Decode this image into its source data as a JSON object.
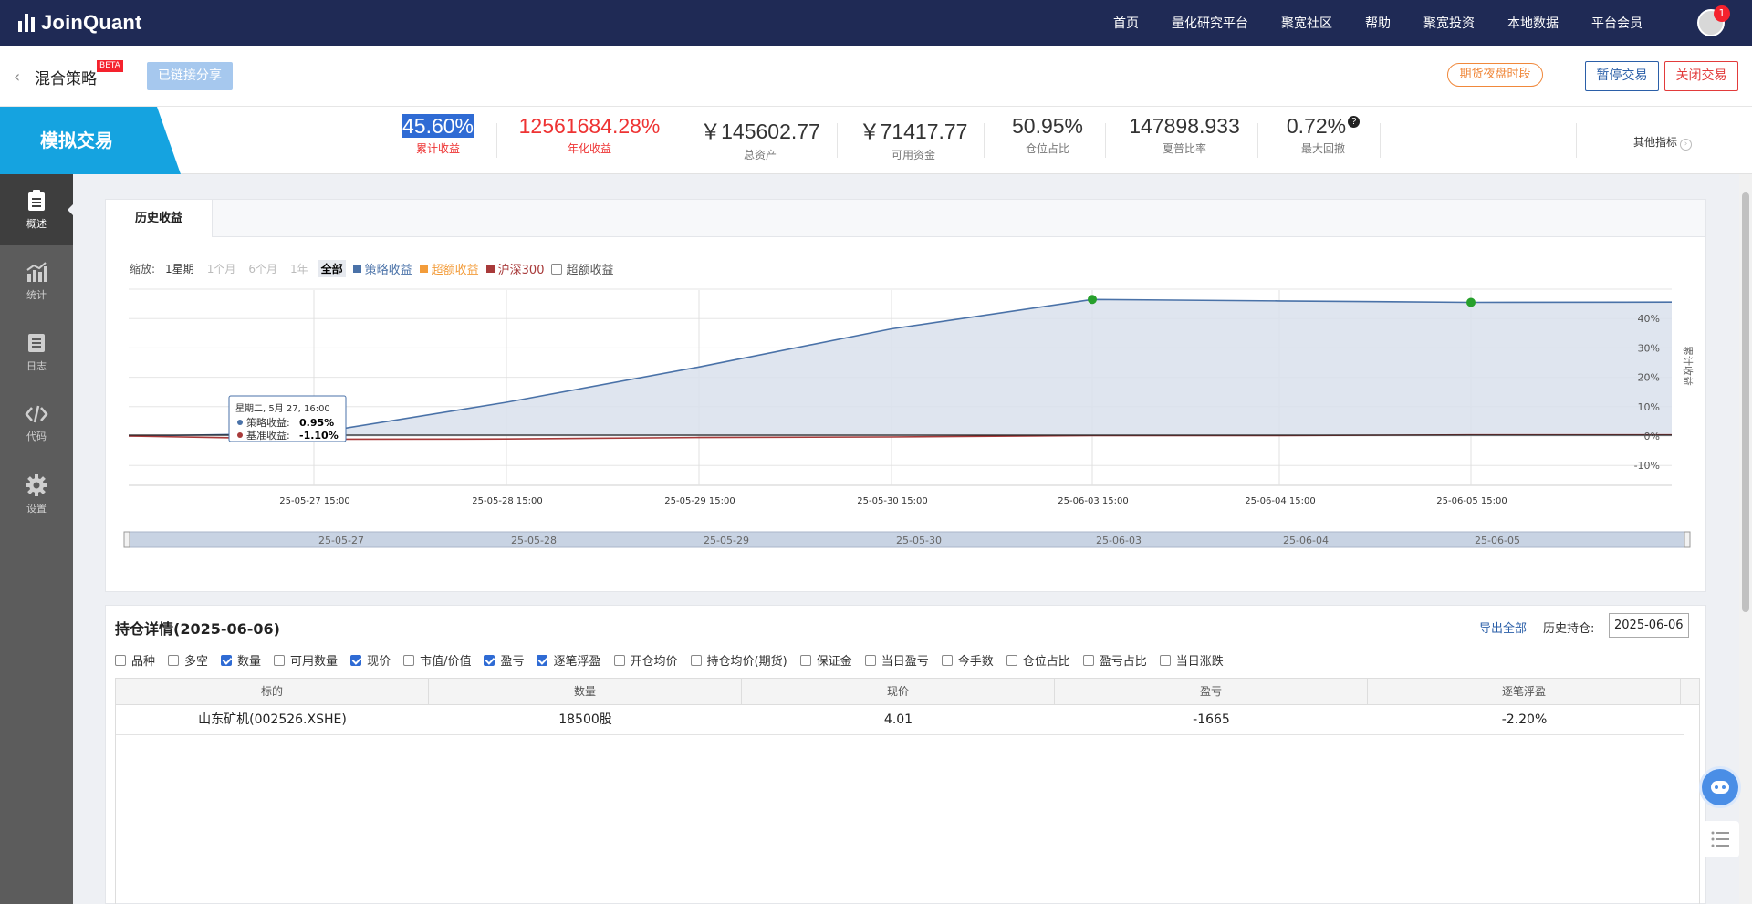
{
  "brand": {
    "name": "JoinQuant"
  },
  "nav": [
    "首页",
    "量化研究平台",
    "聚宽社区",
    "帮助",
    "聚宽投资",
    "本地数据",
    "平台会员"
  ],
  "notif_count": "1",
  "header": {
    "back": "‹",
    "title": "混合策略",
    "beta": "BETA",
    "share_label": "已链接分享",
    "night_session": "期货夜盘时段",
    "pause_label": "暂停交易",
    "close_label": "关闭交易"
  },
  "stats": {
    "tag": "模拟交易",
    "items": [
      {
        "value": "45.60%",
        "label": "累计收益"
      },
      {
        "value": "12561684.28%",
        "label": "年化收益"
      },
      {
        "value": "￥145602.77",
        "label": "总资产"
      },
      {
        "value": "￥71417.77",
        "label": "可用资金"
      },
      {
        "value": "50.95%",
        "label": "仓位占比"
      },
      {
        "value": "147898.933",
        "label": "夏普比率"
      },
      {
        "value": "0.72%",
        "label": "最大回撤"
      }
    ],
    "other": "其他指标"
  },
  "sidebar": [
    {
      "label": "概述",
      "icon": "clipboard-icon"
    },
    {
      "label": "统计",
      "icon": "bar-chart-icon"
    },
    {
      "label": "日志",
      "icon": "list-icon"
    },
    {
      "label": "代码",
      "icon": "code-icon"
    },
    {
      "label": "设置",
      "icon": "gear-icon"
    }
  ],
  "chart_panel": {
    "tab": "历史收益",
    "zoom_label": "缩放:",
    "zoom_options": [
      "1星期",
      "1个月",
      "6个月",
      "1年",
      "全部"
    ],
    "legend": [
      {
        "name": "策略收益",
        "color": "#4a72a8"
      },
      {
        "name": "超额收益",
        "color": "#f39c3a"
      },
      {
        "name": "沪深300",
        "color": "#a83a3a"
      }
    ],
    "excess_checkbox": "超额收益",
    "y_axis_title": "累计收益",
    "tooltip": {
      "date": "星期二, 5月 27, 16:00",
      "line1_label": "策略收益:",
      "line1_value": "0.95%",
      "line2_label": "基准收益:",
      "line2_value": "-1.10%"
    },
    "navigator_labels": [
      "25-05-27",
      "25-05-28",
      "25-05-29",
      "25-05-30",
      "25-06-03",
      "25-06-04",
      "25-06-05"
    ]
  },
  "chart_data": {
    "type": "area",
    "x": [
      "25-05-26 15:00",
      "25-05-27 15:00",
      "25-05-28 15:00",
      "25-05-29 15:00",
      "25-05-30 15:00",
      "25-06-03 15:00",
      "25-06-04 15:00",
      "25-06-05 15:00",
      "25-06-06 15:00"
    ],
    "x_tick_labels": [
      "25-05-27 15:00",
      "25-05-28 15:00",
      "25-05-29 15:00",
      "25-05-30 15:00",
      "25-06-03 15:00",
      "25-06-04 15:00",
      "25-06-05 15:00"
    ],
    "series": [
      {
        "name": "策略收益",
        "color": "#4a72a8",
        "values": [
          0,
          0.95,
          11.5,
          23.5,
          36.5,
          46.5,
          46.0,
          45.5,
          45.6
        ]
      },
      {
        "name": "沪深300",
        "color": "#a83a3a",
        "values": [
          0,
          -1.1,
          -1.0,
          -0.5,
          -0.3,
          0.2,
          0.2,
          0.4,
          0.4
        ]
      }
    ],
    "y_ticks": [
      "-10%",
      "0%",
      "10%",
      "20%",
      "30%",
      "40%"
    ],
    "ylim": [
      -10,
      50
    ],
    "ylabel": "累计收益",
    "markers": [
      {
        "x": "25-06-03 15:00",
        "value": 46.5
      },
      {
        "x": "25-06-05 15:00",
        "value": 45.5
      }
    ],
    "grid": true
  },
  "holdings": {
    "title": "持仓详情(2025-06-06)",
    "export": "导出全部",
    "history_label": "历史持仓:",
    "history_date": "2025-06-06",
    "columns_options": [
      {
        "label": "品种",
        "checked": false
      },
      {
        "label": "多空",
        "checked": false
      },
      {
        "label": "数量",
        "checked": true
      },
      {
        "label": "可用数量",
        "checked": false
      },
      {
        "label": "现价",
        "checked": true
      },
      {
        "label": "市值/价值",
        "checked": false
      },
      {
        "label": "盈亏",
        "checked": true
      },
      {
        "label": "逐笔浮盈",
        "checked": true
      },
      {
        "label": "开仓均价",
        "checked": false
      },
      {
        "label": "持仓均价(期货)",
        "checked": false
      },
      {
        "label": "保证金",
        "checked": false
      },
      {
        "label": "当日盈亏",
        "checked": false
      },
      {
        "label": "今手数",
        "checked": false
      },
      {
        "label": "仓位占比",
        "checked": false
      },
      {
        "label": "盈亏占比",
        "checked": false
      },
      {
        "label": "当日涨跌",
        "checked": false
      }
    ],
    "headers": [
      "标的",
      "数量",
      "现价",
      "盈亏",
      "逐笔浮盈"
    ],
    "rows": [
      [
        "山东矿机(002526.XSHE)",
        "18500股",
        "4.01",
        "-1665",
        "-2.20%"
      ]
    ]
  }
}
